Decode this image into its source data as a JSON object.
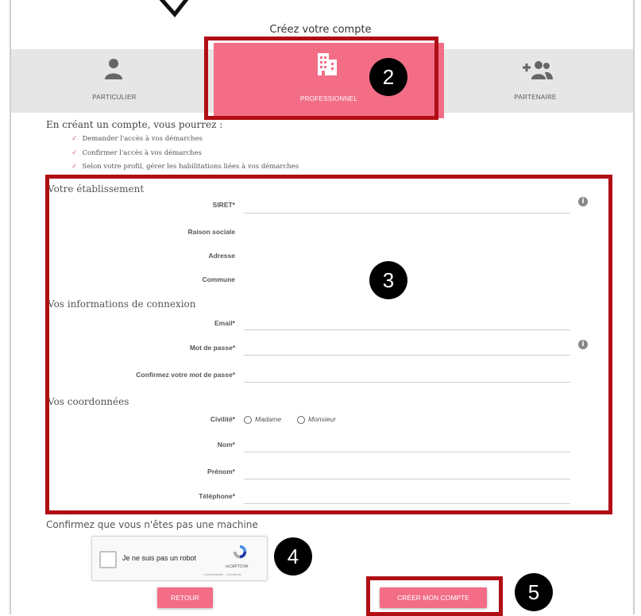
{
  "page_title": "Créez votre compte",
  "tabs": [
    {
      "label": "PARTICULIER",
      "icon": "person-icon"
    },
    {
      "label": "PROFESSIONNEL",
      "icon": "building-icon",
      "active": true
    },
    {
      "label": "PARTENAIRE",
      "icon": "add-partner-icon"
    }
  ],
  "intro": "En créant un compte, vous pourrez :",
  "benefits": [
    "Demander l'accès à vos démarches",
    "Confirmer l'accès à vos démarches",
    "Selon votre profil, gérer les habilitations liées à vos démarches"
  ],
  "establishment": {
    "heading": "Votre établissement",
    "siret_label": "SIRET*",
    "raison_label": "Raison sociale",
    "adresse_label": "Adresse",
    "commune_label": "Commune"
  },
  "connection": {
    "heading": "Vos informations de connexion",
    "email_label": "Email*",
    "password_label": "Mot de passe*",
    "confirm_password_label": "Confirmez votre mot de passe*"
  },
  "contact": {
    "heading": "Vos coordonnées",
    "civility_label": "Civilité*",
    "civility_options": [
      "Madame",
      "Monsieur"
    ],
    "nom_label": "Nom*",
    "prenom_label": "Prénom*",
    "telephone_label": "Téléphone*"
  },
  "captcha": {
    "prompt": "Confirmez que vous n'êtes pas une machine",
    "checkbox_label": "Je ne suis pas un robot",
    "brand": "reCAPTCHA",
    "terms": "Confidentialité - Conditions"
  },
  "buttons": {
    "back": "RETOUR",
    "create": "CRÉER MON COMPTE"
  },
  "annotations": [
    "2",
    "3",
    "4",
    "5"
  ],
  "colors": {
    "accent": "#f36d86",
    "highlight_box": "#b00e14"
  }
}
